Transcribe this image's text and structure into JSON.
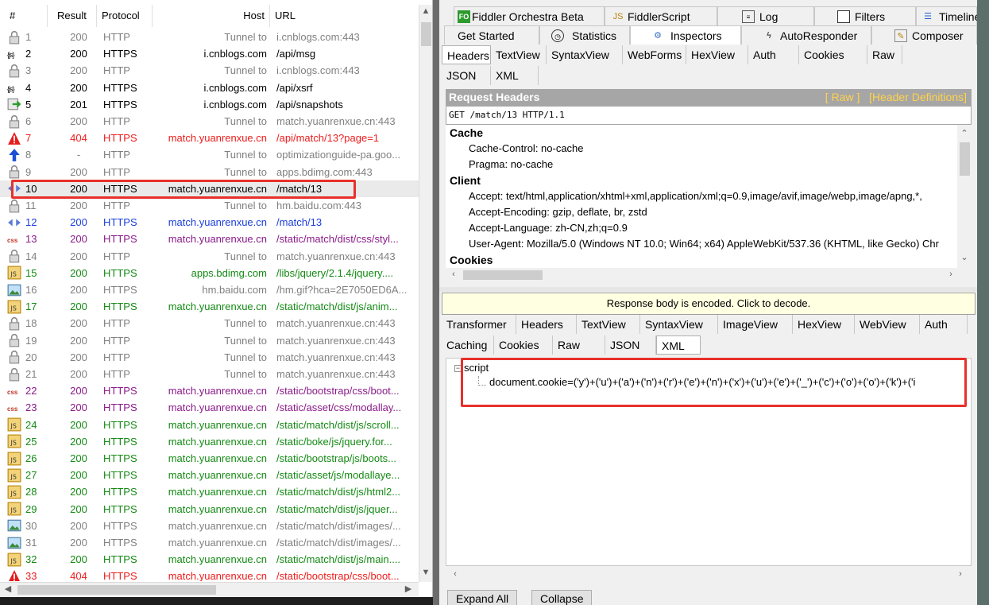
{
  "sessions": {
    "headers": {
      "num": "#",
      "result": "Result",
      "protocol": "Protocol",
      "host": "Host",
      "url": "URL"
    },
    "rows": [
      {
        "n": "1",
        "result": "200",
        "protocol": "HTTP",
        "host": "Tunnel to",
        "url": "i.cnblogs.com:443",
        "color": "grey",
        "icon": "lock-icon"
      },
      {
        "n": "2",
        "result": "200",
        "protocol": "HTTPS",
        "host": "i.cnblogs.com",
        "url": "/api/msg",
        "color": "black",
        "icon": "json-icon"
      },
      {
        "n": "3",
        "result": "200",
        "protocol": "HTTP",
        "host": "Tunnel to",
        "url": "i.cnblogs.com:443",
        "color": "grey",
        "icon": "lock-icon"
      },
      {
        "n": "4",
        "result": "200",
        "protocol": "HTTPS",
        "host": "i.cnblogs.com",
        "url": "/api/xsrf",
        "color": "black",
        "icon": "json-icon"
      },
      {
        "n": "5",
        "result": "201",
        "protocol": "HTTPS",
        "host": "i.cnblogs.com",
        "url": "/api/snapshots",
        "color": "black",
        "icon": "post-icon"
      },
      {
        "n": "6",
        "result": "200",
        "protocol": "HTTP",
        "host": "Tunnel to",
        "url": "match.yuanrenxue.cn:443",
        "color": "grey",
        "icon": "lock-icon"
      },
      {
        "n": "7",
        "result": "404",
        "protocol": "HTTPS",
        "host": "match.yuanrenxue.cn",
        "url": "/api/match/13?page=1",
        "color": "red",
        "icon": "warning-icon"
      },
      {
        "n": "8",
        "result": "-",
        "protocol": "HTTP",
        "host": "Tunnel to",
        "url": "optimizationguide-pa.goo...",
        "color": "grey",
        "icon": "upload-arrow-icon"
      },
      {
        "n": "9",
        "result": "200",
        "protocol": "HTTP",
        "host": "Tunnel to",
        "url": "apps.bdimg.com:443",
        "color": "grey",
        "icon": "lock-icon"
      },
      {
        "n": "10",
        "result": "200",
        "protocol": "HTTPS",
        "host": "match.yuanrenxue.cn",
        "url": "/match/13",
        "color": "black",
        "icon": "html-icon"
      },
      {
        "n": "11",
        "result": "200",
        "protocol": "HTTP",
        "host": "Tunnel to",
        "url": "hm.baidu.com:443",
        "color": "grey",
        "icon": "lock-icon"
      },
      {
        "n": "12",
        "result": "200",
        "protocol": "HTTPS",
        "host": "match.yuanrenxue.cn",
        "url": "/match/13",
        "color": "blue",
        "icon": "html-icon"
      },
      {
        "n": "13",
        "result": "200",
        "protocol": "HTTPS",
        "host": "match.yuanrenxue.cn",
        "url": "/static/match/dist/css/styl...",
        "color": "purple",
        "icon": "css-icon"
      },
      {
        "n": "14",
        "result": "200",
        "protocol": "HTTP",
        "host": "Tunnel to",
        "url": "match.yuanrenxue.cn:443",
        "color": "grey",
        "icon": "lock-icon"
      },
      {
        "n": "15",
        "result": "200",
        "protocol": "HTTPS",
        "host": "apps.bdimg.com",
        "url": "/libs/jquery/2.1.4/jquery....",
        "color": "green",
        "icon": "script-icon"
      },
      {
        "n": "16",
        "result": "200",
        "protocol": "HTTPS",
        "host": "hm.baidu.com",
        "url": "/hm.gif?hca=2E7050ED6A...",
        "color": "grey",
        "icon": "image-icon"
      },
      {
        "n": "17",
        "result": "200",
        "protocol": "HTTPS",
        "host": "match.yuanrenxue.cn",
        "url": "/static/match/dist/js/anim...",
        "color": "green",
        "icon": "script-icon"
      },
      {
        "n": "18",
        "result": "200",
        "protocol": "HTTP",
        "host": "Tunnel to",
        "url": "match.yuanrenxue.cn:443",
        "color": "grey",
        "icon": "lock-icon"
      },
      {
        "n": "19",
        "result": "200",
        "protocol": "HTTP",
        "host": "Tunnel to",
        "url": "match.yuanrenxue.cn:443",
        "color": "grey",
        "icon": "lock-icon"
      },
      {
        "n": "20",
        "result": "200",
        "protocol": "HTTP",
        "host": "Tunnel to",
        "url": "match.yuanrenxue.cn:443",
        "color": "grey",
        "icon": "lock-icon"
      },
      {
        "n": "21",
        "result": "200",
        "protocol": "HTTP",
        "host": "Tunnel to",
        "url": "match.yuanrenxue.cn:443",
        "color": "grey",
        "icon": "lock-icon"
      },
      {
        "n": "22",
        "result": "200",
        "protocol": "HTTPS",
        "host": "match.yuanrenxue.cn",
        "url": "/static/bootstrap/css/boot...",
        "color": "purple",
        "icon": "css-icon"
      },
      {
        "n": "23",
        "result": "200",
        "protocol": "HTTPS",
        "host": "match.yuanrenxue.cn",
        "url": "/static/asset/css/modallay...",
        "color": "purple",
        "icon": "css-icon"
      },
      {
        "n": "24",
        "result": "200",
        "protocol": "HTTPS",
        "host": "match.yuanrenxue.cn",
        "url": "/static/match/dist/js/scroll...",
        "color": "green",
        "icon": "script-icon"
      },
      {
        "n": "25",
        "result": "200",
        "protocol": "HTTPS",
        "host": "match.yuanrenxue.cn",
        "url": "/static/boke/js/jquery.for...",
        "color": "green",
        "icon": "script-icon"
      },
      {
        "n": "26",
        "result": "200",
        "protocol": "HTTPS",
        "host": "match.yuanrenxue.cn",
        "url": "/static/bootstrap/js/boots...",
        "color": "green",
        "icon": "script-icon"
      },
      {
        "n": "27",
        "result": "200",
        "protocol": "HTTPS",
        "host": "match.yuanrenxue.cn",
        "url": "/static/asset/js/modallaye...",
        "color": "green",
        "icon": "script-icon"
      },
      {
        "n": "28",
        "result": "200",
        "protocol": "HTTPS",
        "host": "match.yuanrenxue.cn",
        "url": "/static/match/dist/js/html2...",
        "color": "green",
        "icon": "script-icon"
      },
      {
        "n": "29",
        "result": "200",
        "protocol": "HTTPS",
        "host": "match.yuanrenxue.cn",
        "url": "/static/match/dist/js/jquer...",
        "color": "green",
        "icon": "script-icon"
      },
      {
        "n": "30",
        "result": "200",
        "protocol": "HTTPS",
        "host": "match.yuanrenxue.cn",
        "url": "/static/match/dist/images/...",
        "color": "grey",
        "icon": "image-icon"
      },
      {
        "n": "31",
        "result": "200",
        "protocol": "HTTPS",
        "host": "match.yuanrenxue.cn",
        "url": "/static/match/dist/images/...",
        "color": "grey",
        "icon": "image-icon"
      },
      {
        "n": "32",
        "result": "200",
        "protocol": "HTTPS",
        "host": "match.yuanrenxue.cn",
        "url": "/static/match/dist/js/main....",
        "color": "green",
        "icon": "script-icon"
      },
      {
        "n": "33",
        "result": "404",
        "protocol": "HTTPS",
        "host": "match.yuanrenxue.cn",
        "url": "/static/bootstrap/css/boot...",
        "color": "red",
        "icon": "warning-icon"
      }
    ],
    "selected_index": 9
  },
  "top_tabs_row1": [
    {
      "label": "Fiddler Orchestra Beta",
      "icon": "fo-icon"
    },
    {
      "label": "FiddlerScript",
      "icon": "script-icon"
    },
    {
      "label": "Log",
      "icon": "log-icon"
    },
    {
      "label": "Filters",
      "icon": "checkbox-icon"
    },
    {
      "label": "Timeline",
      "icon": "timeline-icon"
    }
  ],
  "top_tabs_row2": [
    {
      "label": "Get Started",
      "icon": ""
    },
    {
      "label": "Statistics",
      "icon": "stopwatch-icon"
    },
    {
      "label": "Inspectors",
      "icon": "inspect-icon"
    },
    {
      "label": "AutoResponder",
      "icon": "lightning-icon"
    },
    {
      "label": "Composer",
      "icon": "compose-icon"
    }
  ],
  "request_tabs_row1": [
    "Headers",
    "TextView",
    "SyntaxView",
    "WebForms",
    "HexView",
    "Auth",
    "Cookies",
    "Raw"
  ],
  "request_tabs_row2": [
    "JSON",
    "XML"
  ],
  "request_headers": {
    "title": "Request Headers",
    "raw_link": "[ Raw ]",
    "defs_link": "[Header Definitions]",
    "request_line": "GET /match/13 HTTP/1.1",
    "sections": [
      {
        "name": "Cache",
        "items": [
          "Cache-Control: no-cache",
          "Pragma: no-cache"
        ]
      },
      {
        "name": "Client",
        "items": [
          "Accept: text/html,application/xhtml+xml,application/xml;q=0.9,image/avif,image/webp,image/apng,*,",
          "Accept-Encoding: gzip, deflate, br, zstd",
          "Accept-Language: zh-CN,zh;q=0.9",
          "User-Agent: Mozilla/5.0 (Windows NT 10.0; Win64; x64) AppleWebKit/537.36 (KHTML, like Gecko) Chr"
        ]
      },
      {
        "name": "Cookies",
        "items": []
      }
    ]
  },
  "response": {
    "encoded_notice": "Response body is encoded. Click to decode.",
    "tabs_row1": [
      "Transformer",
      "Headers",
      "TextView",
      "SyntaxView",
      "ImageView",
      "HexView",
      "WebView",
      "Auth"
    ],
    "tabs_row2": [
      "Caching",
      "Cookies",
      "Raw",
      "JSON",
      "XML"
    ],
    "tree_root": "script",
    "tree_child": "document.cookie=('y')+('u')+('a')+('n')+('r')+('e')+('n')+('x')+('u')+('e')+('_')+('c')+('o')+('o')+('k')+('i",
    "expand_all": "Expand All",
    "collapse": "Collapse"
  }
}
